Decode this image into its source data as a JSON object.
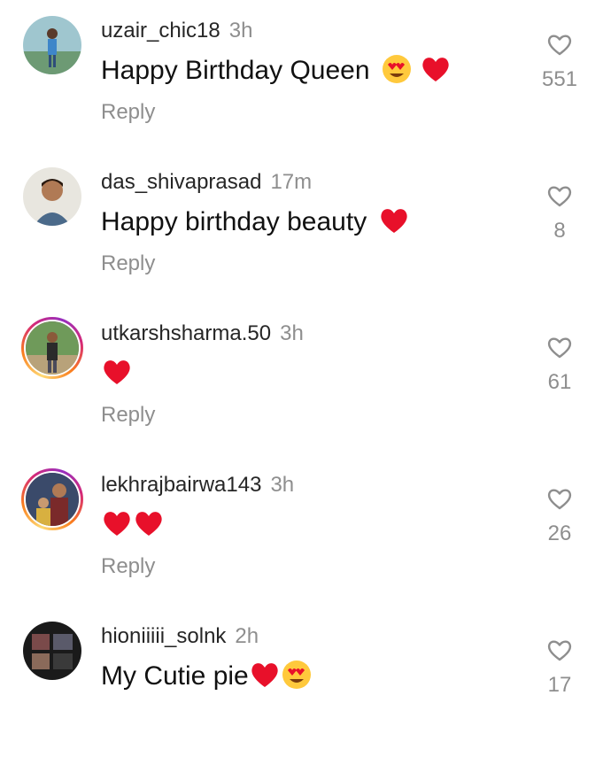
{
  "comments": [
    {
      "username": "uzair_chic18",
      "time": "3h",
      "text": "Happy Birthday Queen",
      "reply": "Reply",
      "likes": "551",
      "avatar_ring": false
    },
    {
      "username": "das_shivaprasad",
      "time": "17m",
      "text": "Happy birthday beauty",
      "reply": "Reply",
      "likes": "8",
      "avatar_ring": false
    },
    {
      "username": "utkarshsharma.50",
      "time": "3h",
      "text": "",
      "reply": "Reply",
      "likes": "61",
      "avatar_ring": true
    },
    {
      "username": "lekhrajbairwa143",
      "time": "3h",
      "text": "",
      "reply": "Reply",
      "likes": "26",
      "avatar_ring": true
    },
    {
      "username": "hioniiiii_solnk",
      "time": "2h",
      "text": "My Cutie pie",
      "reply": "Reply",
      "likes": "17",
      "avatar_ring": false
    }
  ],
  "icons": {
    "like": "heart-outline-icon",
    "emoji_love": "heart-eyes-emoji",
    "emoji_heart": "red-heart-emoji"
  },
  "colors": {
    "muted": "#8e8e8e",
    "heart_red": "#e8102a",
    "emoji_yellow": "#ffc93c",
    "story_ring": "#d62976"
  }
}
